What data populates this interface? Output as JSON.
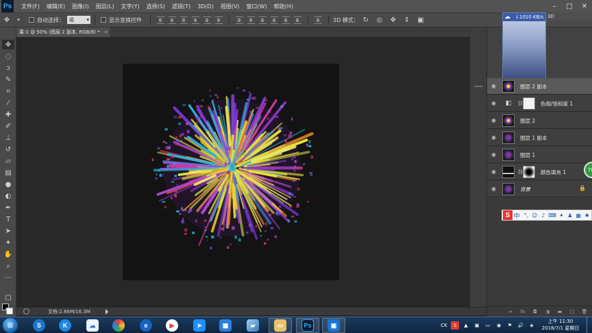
{
  "app": {
    "logo": "Ps",
    "menu": [
      "文件(F)",
      "编辑(E)",
      "图像(I)",
      "图层(L)",
      "文字(Y)",
      "选择(S)",
      "滤镜(T)",
      "3D(D)",
      "视图(V)",
      "窗口(W)",
      "帮助(H)"
    ],
    "window_controls": {
      "minimize": "–",
      "maximize": "□",
      "close": "✕"
    }
  },
  "options_bar": {
    "auto_select_label": "自动选择：",
    "auto_select_value": "组",
    "show_transform_label": "显示变换控件",
    "mode_3d_label": "3D 模式："
  },
  "document": {
    "tab_title": "果-1 @ 50% (图层 2 副本, RGB/8) *",
    "tab_close": "×",
    "status_size": "文档:2.86M/16.3M"
  },
  "network_widget": {
    "speed": "↓1010 KB/s"
  },
  "panel_3d_label": "3D",
  "layers": [
    {
      "name": "图层 2 副本",
      "thumb": "firework",
      "selected": true,
      "has_mask": false,
      "italic": false,
      "locked": false
    },
    {
      "name": "色相/饱和度 1",
      "thumb": "adjust",
      "selected": false,
      "has_mask": true,
      "mask": "white",
      "italic": false,
      "locked": false
    },
    {
      "name": "图层 2",
      "thumb": "firework",
      "selected": false,
      "has_mask": false,
      "italic": false,
      "locked": false
    },
    {
      "name": "图层 1 副本",
      "thumb": "bg",
      "selected": false,
      "has_mask": false,
      "italic": false,
      "locked": false
    },
    {
      "name": "图层 1",
      "thumb": "bg",
      "selected": false,
      "has_mask": false,
      "italic": false,
      "locked": false
    },
    {
      "name": "颜色填充 1",
      "thumb": "dark-band",
      "selected": false,
      "has_mask": true,
      "mask": "radial",
      "italic": false,
      "locked": false
    },
    {
      "name": "背景",
      "thumb": "bg",
      "selected": false,
      "has_mask": false,
      "italic": true,
      "locked": true
    }
  ],
  "green_badge": "78",
  "ime": {
    "logo": "S",
    "mode": "中"
  },
  "taskbar": {
    "clock_time": "上午 11:30",
    "clock_date": "2018/7/1 星期日",
    "tray_ck": "CK"
  },
  "colors": {
    "accent_ps": "#31a8ff",
    "selected_layer": "#595959",
    "canvas_bg": "#131313"
  }
}
